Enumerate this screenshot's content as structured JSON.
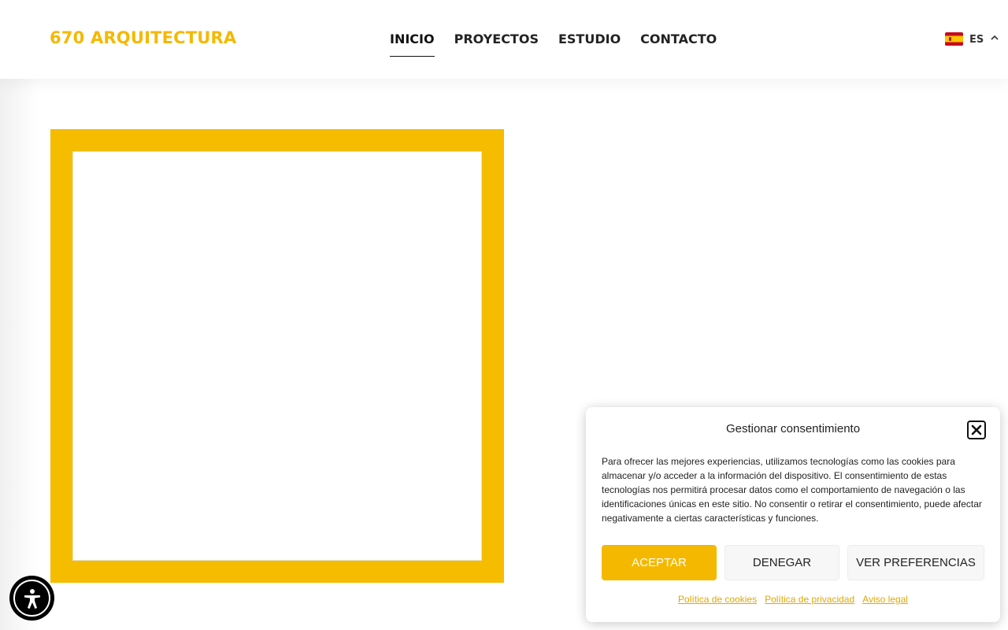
{
  "header": {
    "logo": "670 ARQUITECTURA",
    "nav": [
      {
        "label": "INICIO",
        "active": true
      },
      {
        "label": "PROYECTOS",
        "active": false
      },
      {
        "label": "ESTUDIO",
        "active": false
      },
      {
        "label": "CONTACTO",
        "active": false
      }
    ],
    "language": {
      "code": "ES",
      "flag": "spain-flag-icon"
    }
  },
  "colors": {
    "accent": "#f5b800",
    "text": "#222222"
  },
  "consent": {
    "title": "Gestionar consentimiento",
    "body": "Para ofrecer las mejores experiencias, utilizamos tecnologías como las cookies para almacenar y/o acceder a la información del dispositivo. El consentimiento de estas tecnologías nos permitirá procesar datos como el comportamiento de navegación o las identificaciones únicas en este sitio. No consentir o retirar el consentimiento, puede afectar negativamente a ciertas características y funciones.",
    "buttons": {
      "accept": "ACEPTAR",
      "deny": "DENEGAR",
      "preferences": "VER PREFERENCIAS"
    },
    "links": [
      {
        "label": "Política de cookies"
      },
      {
        "label": "Política de privacidad"
      },
      {
        "label": "Aviso legal"
      }
    ]
  }
}
